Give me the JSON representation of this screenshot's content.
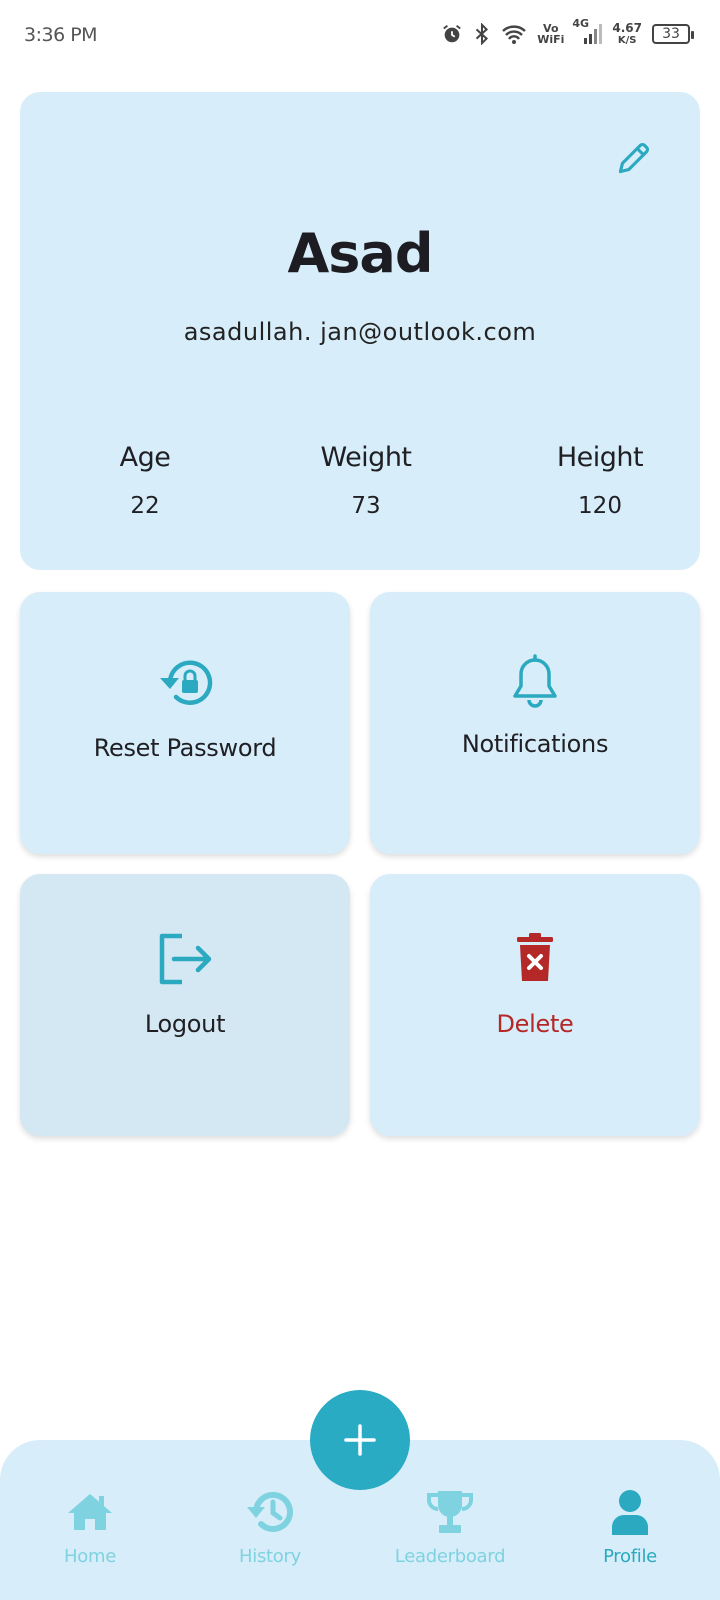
{
  "status_bar": {
    "time": "3:36 PM",
    "network_vo": "Vo",
    "network_wifi": "WiFi",
    "network_type": "4G",
    "speed_value": "4.67",
    "speed_unit": "K/S",
    "battery": "33",
    "icons": [
      "alarm-icon",
      "bluetooth-icon",
      "wifi-icon",
      "signal-icon",
      "battery-icon"
    ]
  },
  "profile": {
    "name": "Asad",
    "email": "asadullah. jan@outlook.com",
    "stats": [
      {
        "label": "Age",
        "value": "22"
      },
      {
        "label": "Weight",
        "value": "73"
      },
      {
        "label": "Height",
        "value": "120"
      }
    ]
  },
  "actions": {
    "reset_password": "Reset Password",
    "notifications": "Notifications",
    "logout": "Logout",
    "delete": "Delete"
  },
  "nav": {
    "items": [
      {
        "label": "Home",
        "icon": "home-icon"
      },
      {
        "label": "History",
        "icon": "history-icon"
      },
      {
        "label": "Leaderboard",
        "icon": "trophy-icon"
      },
      {
        "label": "Profile",
        "icon": "person-icon",
        "active": true
      }
    ],
    "fab_icon": "plus-icon"
  },
  "colors": {
    "card_bg": "#d7edf9",
    "accent": "#29abc3",
    "nav_inactive": "#7fd2e0",
    "delete_red": "#b52828"
  }
}
